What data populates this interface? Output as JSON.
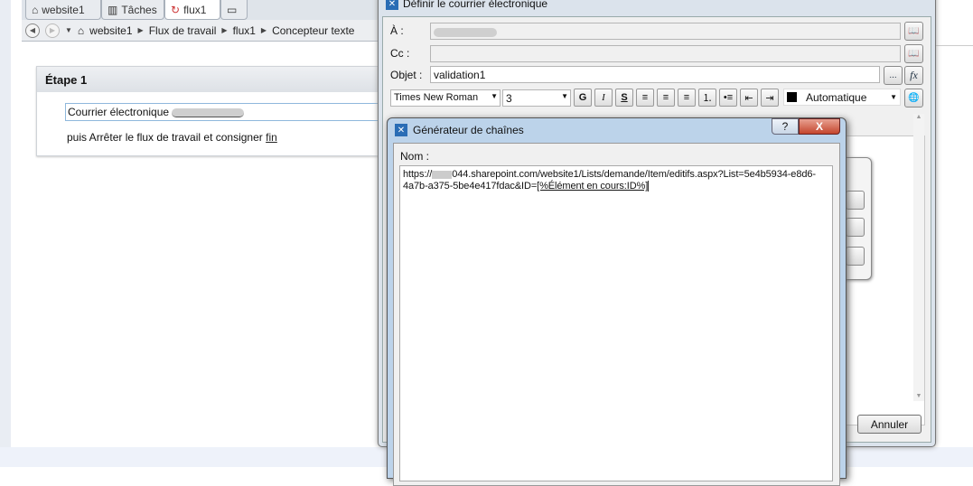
{
  "tabs": [
    {
      "label": "website1",
      "icon": "home-icon"
    },
    {
      "label": "Tâches",
      "icon": "table-icon"
    },
    {
      "label": "flux1",
      "icon": "workflow-icon",
      "active": true
    },
    {
      "label": "",
      "icon": "new-tab-icon"
    }
  ],
  "breadcrumb": [
    "website1",
    "Flux de travail",
    "flux1",
    "Concepteur texte"
  ],
  "step": {
    "title": "Étape 1",
    "action_prefix": "Courrier électronique",
    "action_line2": "puis Arrêter le flux de travail et consigner",
    "link": "fin"
  },
  "email_dialog": {
    "title": "Définir le courrier électronique",
    "to_label": "À :",
    "cc_label": "Cc :",
    "subject_label": "Objet :",
    "subject_value": "validation1",
    "font": "Times New Roman",
    "size": "3",
    "bold": "G",
    "italic": "I",
    "underline": "S",
    "color_label": "Automatique",
    "cancel": "Annuler",
    "ellipsis": "...",
    "fx": "fx"
  },
  "string_builder": {
    "title": "Générateur de chaînes",
    "help": "?",
    "close": "X",
    "name_label": "Nom :",
    "url_prefix": "https://",
    "url_rest": "044.sharepoint.com/website1/Lists/demande/Item/editifs.aspx?List=5e4b5934-e8d6-4a7b-a375-5be4e417fdac&ID=",
    "lookup": "[%Élément en cours:ID%]"
  },
  "colors": {
    "accent": "#2a6db5",
    "close": "#c4452d"
  }
}
